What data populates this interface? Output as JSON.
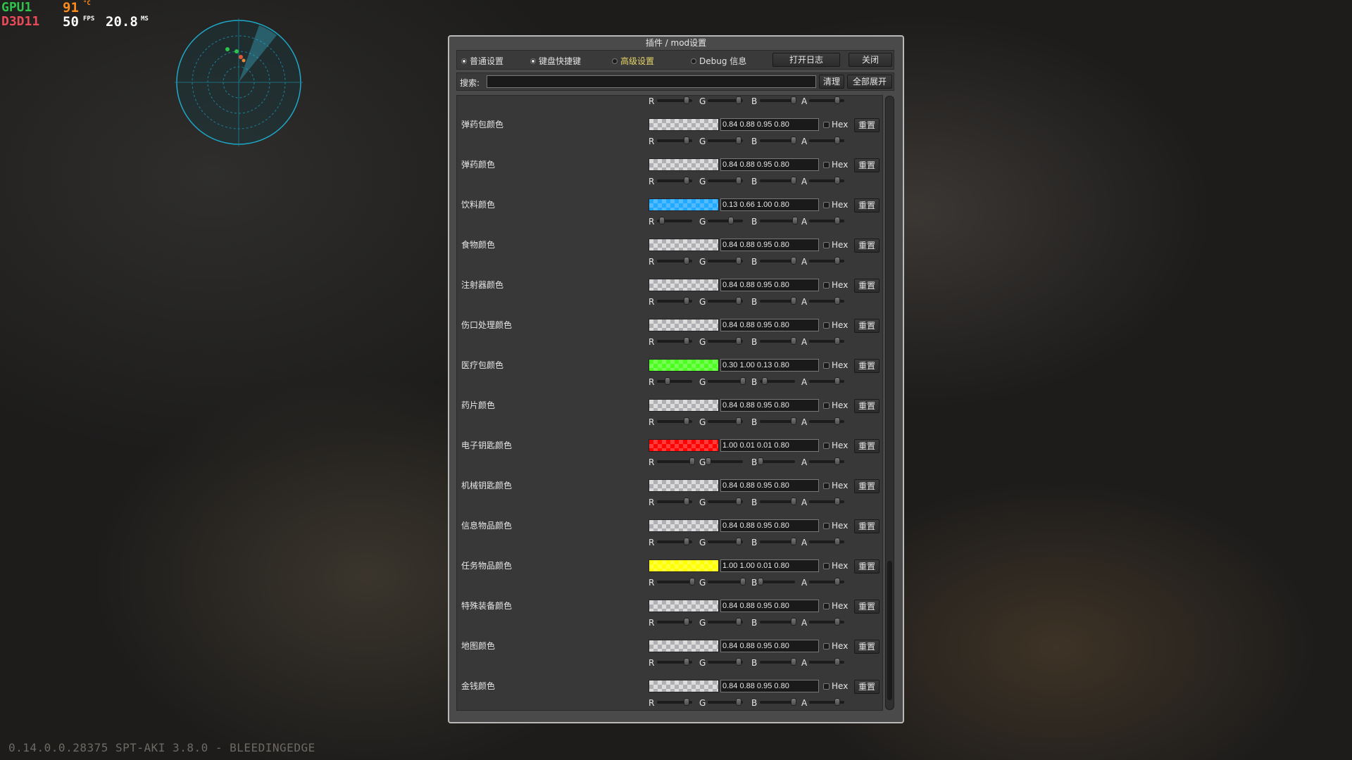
{
  "hud": {
    "gpu_label": "GPU1",
    "gpu_temp": "91",
    "temp_unit": "°C",
    "api": "D3D11",
    "fps": "50",
    "fps_unit": "FPS",
    "frametime": "20.8",
    "frametime_unit": "MS"
  },
  "build_version": "0.14.0.0.28375 SPT-AKI 3.8.0 - BLEEDINGEDGE",
  "window": {
    "title": "插件 / mod设置",
    "tabs": [
      {
        "label": "普通设置",
        "selected": true
      },
      {
        "label": "键盘快捷键",
        "selected": true
      },
      {
        "label": "高级设置",
        "selected": false,
        "active": true
      },
      {
        "label": "Debug 信息",
        "selected": false
      }
    ],
    "open_log_label": "打开日志",
    "close_label": "关闭",
    "search_label": "搜索:",
    "search_value": "",
    "clear_label": "清理",
    "expand_all_label": "全部展开"
  },
  "slider_labels": {
    "r": "R",
    "g": "G",
    "b": "B",
    "a": "A"
  },
  "hex_label": "Hex",
  "reset_label": "重置",
  "color_rows": [
    {
      "label": "弹药包颜色",
      "value": "0.84 0.88 0.95 0.80",
      "rgba": [
        0.84,
        0.88,
        0.95,
        0.8
      ],
      "swatch": "#d6e0f2"
    },
    {
      "label": "弹药颜色",
      "value": "0.84 0.88 0.95 0.80",
      "rgba": [
        0.84,
        0.88,
        0.95,
        0.8
      ],
      "swatch": "#d6e0f2"
    },
    {
      "label": "饮料颜色",
      "value": "0.13 0.66 1.00 0.80",
      "rgba": [
        0.13,
        0.66,
        1.0,
        0.8
      ],
      "swatch": "#21a8ff"
    },
    {
      "label": "食物颜色",
      "value": "0.84 0.88 0.95 0.80",
      "rgba": [
        0.84,
        0.88,
        0.95,
        0.8
      ],
      "swatch": "#d6e0f2"
    },
    {
      "label": "注射器颜色",
      "value": "0.84 0.88 0.95 0.80",
      "rgba": [
        0.84,
        0.88,
        0.95,
        0.8
      ],
      "swatch": "#d6e0f2"
    },
    {
      "label": "伤口处理颜色",
      "value": "0.84 0.88 0.95 0.80",
      "rgba": [
        0.84,
        0.88,
        0.95,
        0.8
      ],
      "swatch": "#d6e0f2"
    },
    {
      "label": "医疗包颜色",
      "value": "0.30 1.00 0.13 0.80",
      "rgba": [
        0.3,
        1.0,
        0.13,
        0.8
      ],
      "swatch": "#4dff21"
    },
    {
      "label": "药片颜色",
      "value": "0.84 0.88 0.95 0.80",
      "rgba": [
        0.84,
        0.88,
        0.95,
        0.8
      ],
      "swatch": "#d6e0f2"
    },
    {
      "label": "电子钥匙颜色",
      "value": "1.00 0.01 0.01 0.80",
      "rgba": [
        1.0,
        0.01,
        0.01,
        0.8
      ],
      "swatch": "#ff0303"
    },
    {
      "label": "机械钥匙颜色",
      "value": "0.84 0.88 0.95 0.80",
      "rgba": [
        0.84,
        0.88,
        0.95,
        0.8
      ],
      "swatch": "#d6e0f2"
    },
    {
      "label": "信息物品颜色",
      "value": "0.84 0.88 0.95 0.80",
      "rgba": [
        0.84,
        0.88,
        0.95,
        0.8
      ],
      "swatch": "#d6e0f2"
    },
    {
      "label": "任务物品颜色",
      "value": "1.00 1.00 0.01 0.80",
      "rgba": [
        1.0,
        1.0,
        0.01,
        0.8
      ],
      "swatch": "#ffff03"
    },
    {
      "label": "特殊装备颜色",
      "value": "0.84 0.88 0.95 0.80",
      "rgba": [
        0.84,
        0.88,
        0.95,
        0.8
      ],
      "swatch": "#d6e0f2"
    },
    {
      "label": "地图颜色",
      "value": "0.84 0.88 0.95 0.80",
      "rgba": [
        0.84,
        0.88,
        0.95,
        0.8
      ],
      "swatch": "#d6e0f2"
    },
    {
      "label": "金钱颜色",
      "value": "0.84 0.88 0.95 0.80",
      "rgba": [
        0.84,
        0.88,
        0.95,
        0.8
      ],
      "swatch": "#d6e0f2"
    }
  ]
}
